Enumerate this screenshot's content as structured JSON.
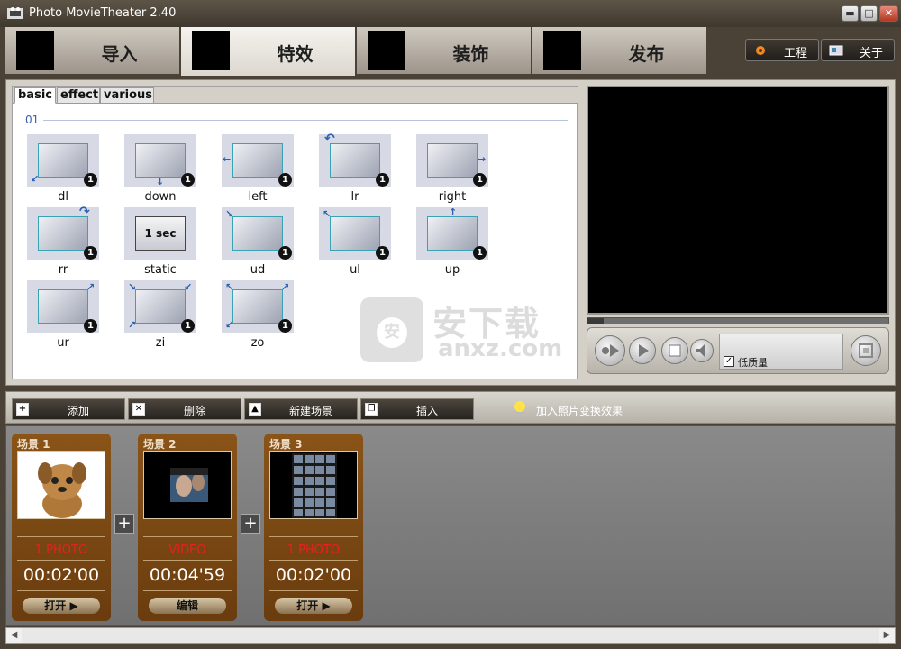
{
  "window": {
    "title": "Photo MovieTheater 2.40",
    "min_glyph": "▬",
    "max_glyph": "□",
    "close_glyph": "✕"
  },
  "main_tabs": [
    {
      "label": "导入"
    },
    {
      "label": "特效"
    },
    {
      "label": "装饰"
    },
    {
      "label": "发布"
    }
  ],
  "top_buttons": {
    "project": "工程",
    "about": "关于"
  },
  "sub_tabs": [
    "basic",
    "effect",
    "various"
  ],
  "group_label": "01",
  "effects": [
    {
      "label": "dl",
      "badge": "1"
    },
    {
      "label": "down",
      "badge": "1"
    },
    {
      "label": "left",
      "badge": "1"
    },
    {
      "label": "lr",
      "badge": "1"
    },
    {
      "label": "right",
      "badge": "1"
    },
    {
      "label": "rr",
      "badge": "1"
    },
    {
      "label": "static",
      "badge": "",
      "screen_text": "1 sec"
    },
    {
      "label": "ud",
      "badge": "1"
    },
    {
      "label": "ul",
      "badge": "1"
    },
    {
      "label": "up",
      "badge": "1"
    },
    {
      "label": "ur",
      "badge": "1"
    },
    {
      "label": "zi",
      "badge": "1"
    },
    {
      "label": "zo",
      "badge": "1"
    }
  ],
  "watermark": {
    "cn": "安下载",
    "en": "anxz.com",
    "badge": "安"
  },
  "player": {
    "low_quality_label": "低质量",
    "low_quality_checked": true
  },
  "toolbar": {
    "add": "添加",
    "delete": "删除",
    "new_scene": "新建场景",
    "insert": "插入",
    "hint": "加入照片变换效果"
  },
  "scenes": [
    {
      "title": "场景 1",
      "type": "1 PHOTO",
      "duration": "00:02'00",
      "button": "打开 ▶"
    },
    {
      "title": "场景 2",
      "type": "VIDEO",
      "duration": "00:04'59",
      "button": "编辑"
    },
    {
      "title": "场景 3",
      "type": "1 PHOTO",
      "duration": "00:02'00",
      "button": "打开 ▶"
    }
  ],
  "plus_label": "+",
  "scroll": {
    "left": "◀",
    "right": "▶"
  },
  "colors": {
    "accent_red": "#e82020",
    "scene_brown": "#7a4a14",
    "link_blue": "#3a5fa8"
  }
}
